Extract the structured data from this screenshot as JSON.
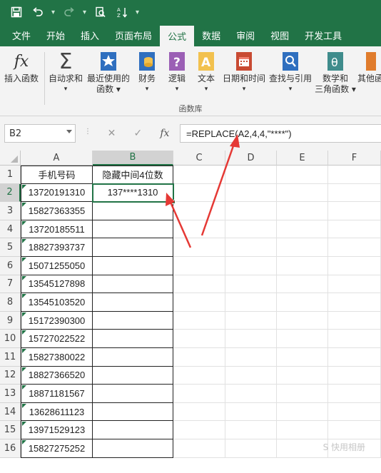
{
  "tabs": [
    "文件",
    "开始",
    "插入",
    "页面布局",
    "公式",
    "数据",
    "审阅",
    "视图",
    "开发工具"
  ],
  "active_tab": "公式",
  "ribbon": {
    "insert_fn": "插入函数",
    "autosum": "自动求和",
    "recent": [
      "最近使用的",
      "函数"
    ],
    "finance": "财务",
    "logic": "逻辑",
    "text": "文本",
    "datetime": "日期和时间",
    "lookup": "查找与引用",
    "math": [
      "数学和",
      "三角函数"
    ],
    "other": "其他函",
    "group_title": "函数库"
  },
  "namebox": "B2",
  "formula": "=REPLACE(A2,4,4,\"****\")",
  "columns": [
    "A",
    "B",
    "C",
    "D",
    "E",
    "F"
  ],
  "rows": [
    "1",
    "2",
    "3",
    "4",
    "5",
    "6",
    "7",
    "8",
    "9",
    "10",
    "11",
    "12",
    "13",
    "14",
    "15",
    "16"
  ],
  "headers": {
    "a1": "手机号码",
    "b1": "隐藏中间4位数"
  },
  "phones": [
    "13720191310",
    "15827363355",
    "13720185511",
    "18827393737",
    "15071255050",
    "13545127898",
    "13545103520",
    "15172390300",
    "15727022522",
    "15827380022",
    "18827366520",
    "18871181567",
    "13628611123",
    "13971529123",
    "15827275252"
  ],
  "b2_value": "137****1310",
  "watermark": "S 快用相册",
  "colors": {
    "accent": "#217346",
    "arrow": "#e53935"
  }
}
